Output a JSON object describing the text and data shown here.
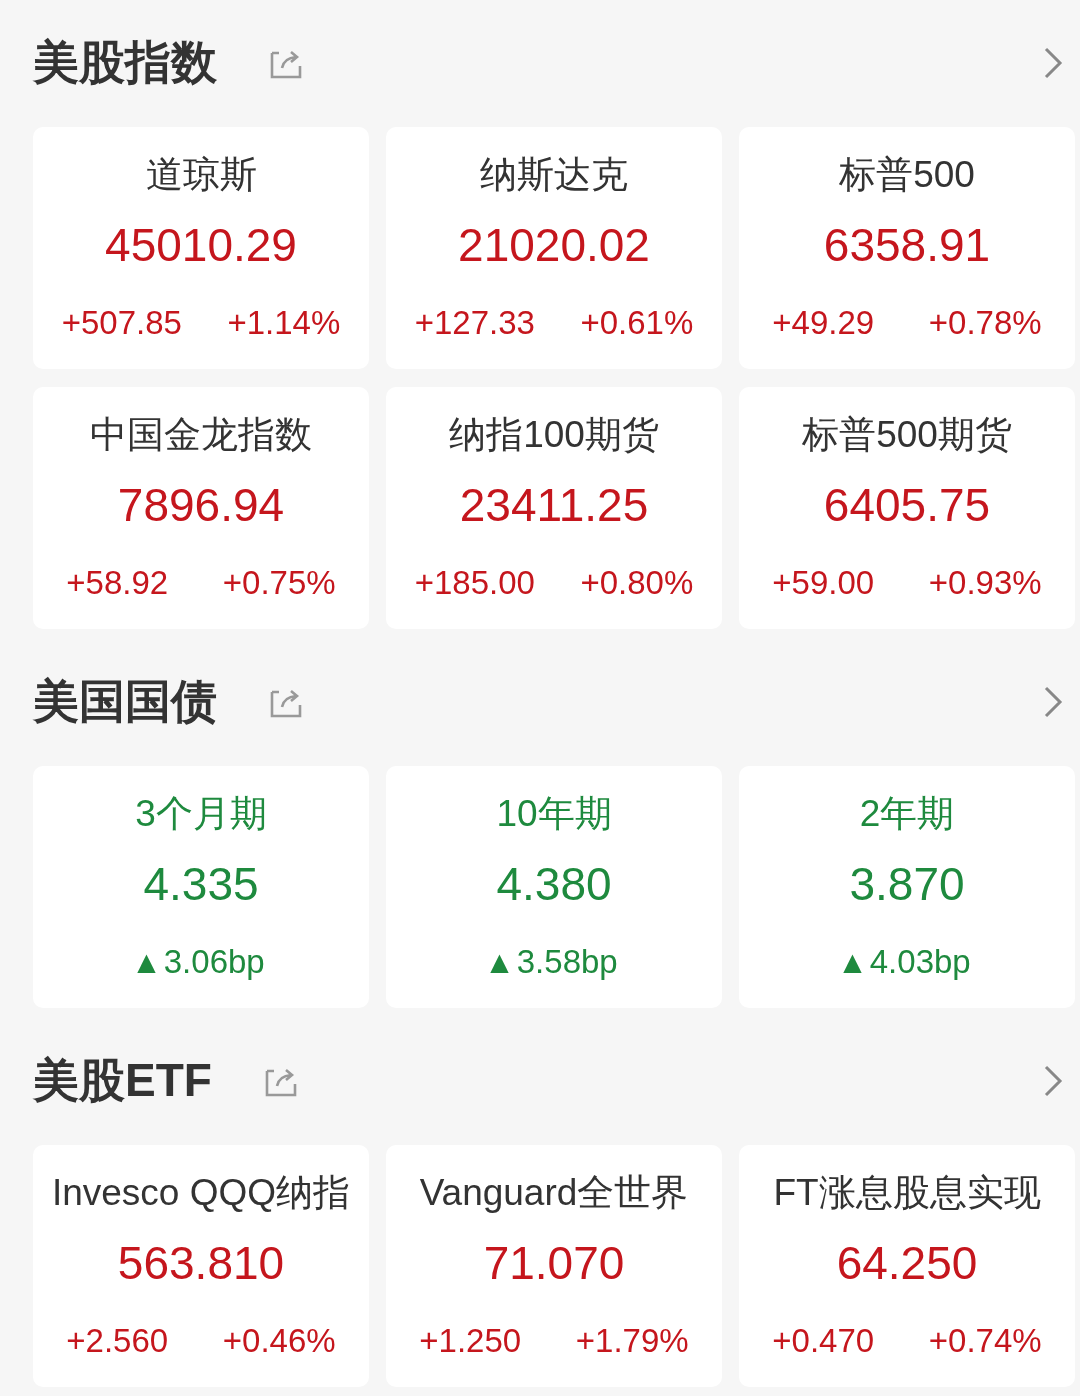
{
  "sections": [
    {
      "title": "美股指数",
      "kind": "index",
      "items": [
        {
          "name": "道琼斯",
          "value": "45010.29",
          "change": "+507.85",
          "percent": "+1.14%"
        },
        {
          "name": "纳斯达克",
          "value": "21020.02",
          "change": "+127.33",
          "percent": "+0.61%"
        },
        {
          "name": "标普500",
          "value": "6358.91",
          "change": "+49.29",
          "percent": "+0.78%"
        },
        {
          "name": "中国金龙指数",
          "value": "7896.94",
          "change": "+58.92",
          "percent": "+0.75%"
        },
        {
          "name": "纳指100期货",
          "value": "23411.25",
          "change": "+185.00",
          "percent": "+0.80%"
        },
        {
          "name": "标普500期货",
          "value": "6405.75",
          "change": "+59.00",
          "percent": "+0.93%"
        }
      ]
    },
    {
      "title": "美国国债",
      "kind": "bond",
      "items": [
        {
          "name": "3个月期",
          "value": "4.335",
          "arrow": "▲",
          "change": "3.06bp"
        },
        {
          "name": "10年期",
          "value": "4.380",
          "arrow": "▲",
          "change": "3.58bp"
        },
        {
          "name": "2年期",
          "value": "3.870",
          "arrow": "▲",
          "change": "4.03bp"
        }
      ]
    },
    {
      "title": "美股ETF",
      "kind": "index",
      "items": [
        {
          "name": "Invesco QQQ纳指",
          "value": "563.810",
          "change": "+2.560",
          "percent": "+0.46%"
        },
        {
          "name": "Vanguard全世界",
          "value": "71.070",
          "change": "+1.250",
          "percent": "+1.79%"
        },
        {
          "name": "FT涨息股息实现",
          "value": "64.250",
          "change": "+0.470",
          "percent": "+0.74%"
        }
      ]
    }
  ]
}
